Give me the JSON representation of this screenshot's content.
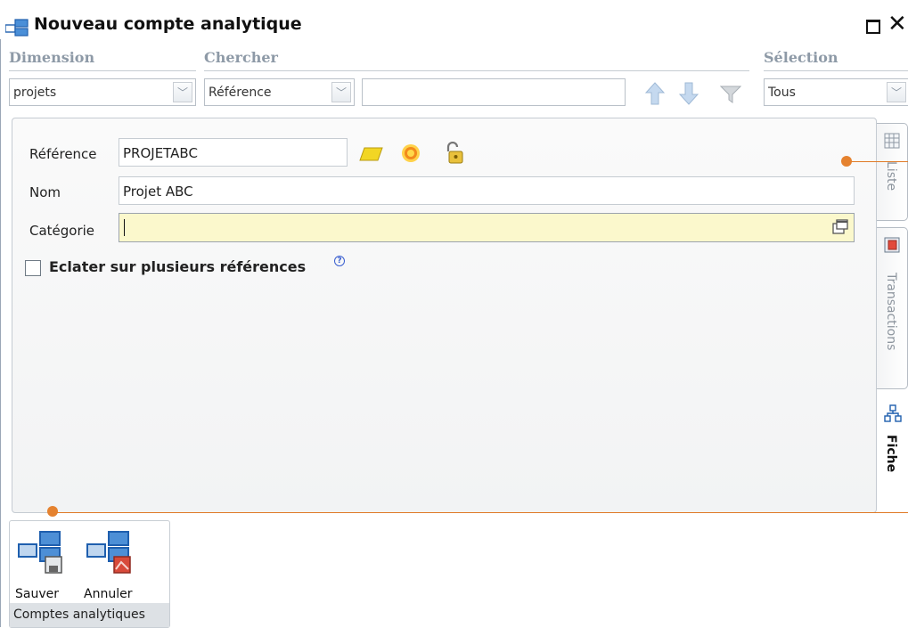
{
  "window": {
    "title": "Nouveau compte analytique"
  },
  "filters": {
    "dimension_label": "Dimension",
    "dimension_value": "projets",
    "search_label": "Chercher",
    "search_field_value": "Référence",
    "search_text": "",
    "selection_label": "Sélection",
    "selection_value": "Tous"
  },
  "form": {
    "reference_label": "Référence",
    "reference_value": "PROJETABC",
    "name_label": "Nom",
    "name_value": "Projet ABC",
    "category_label": "Catégorie",
    "category_value": "",
    "split_checkbox_label": "Eclater sur plusieurs références",
    "split_checked": false
  },
  "side_tabs": [
    {
      "label": "Liste",
      "active": false
    },
    {
      "label": "Transactions",
      "active": false
    },
    {
      "label": "Fiche",
      "active": true
    }
  ],
  "toolbar": {
    "save_label": "Sauver",
    "cancel_label": "Annuler",
    "group_label": "Comptes analytiques"
  },
  "colors": {
    "accent": "#e5822f",
    "category_bg": "#fbf8cc",
    "label_gray": "#8e9aa7"
  },
  "icons": {
    "reference_actions": [
      "eraser-icon",
      "sun-icon",
      "padlock-icon"
    ],
    "nav": [
      "arrow-up-icon",
      "arrow-down-icon",
      "filter-icon"
    ]
  }
}
